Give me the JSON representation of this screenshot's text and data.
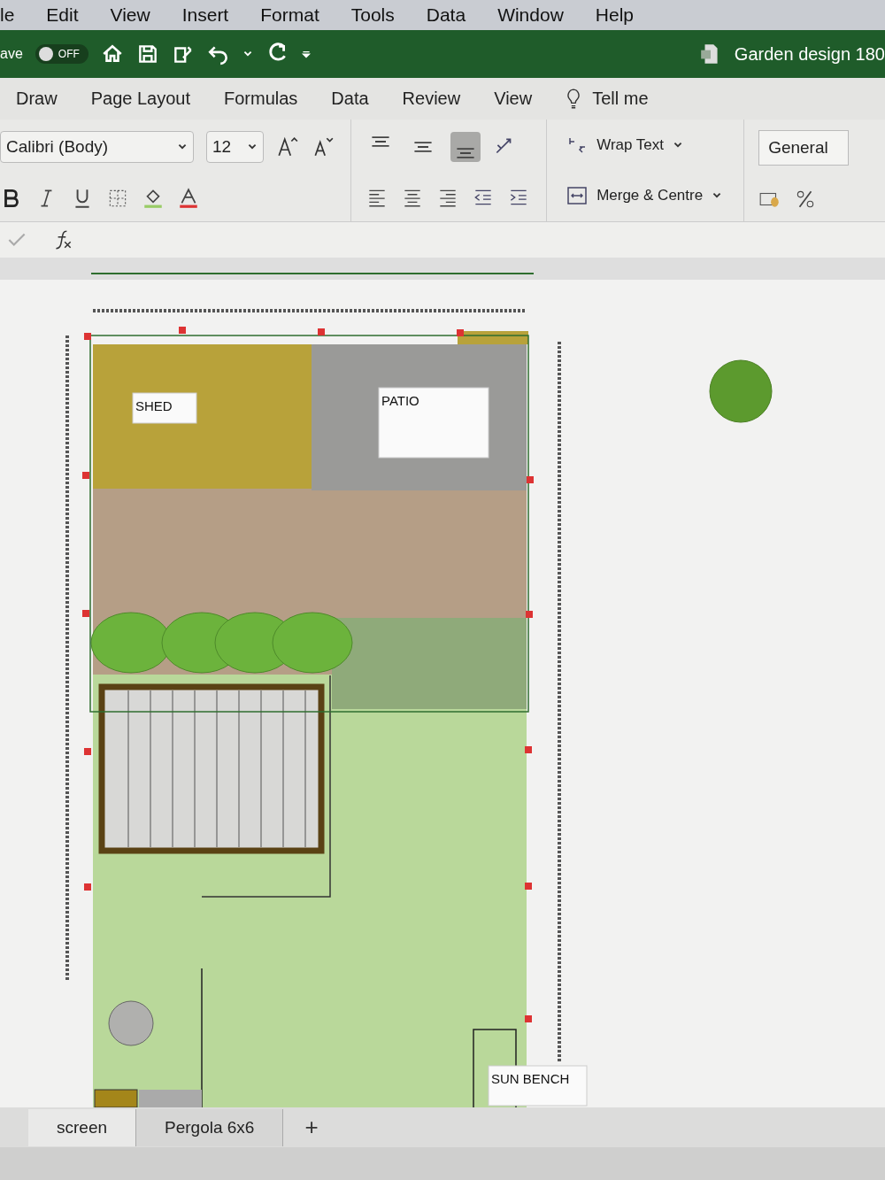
{
  "menu_bar": [
    "le",
    "Edit",
    "View",
    "Insert",
    "Format",
    "Tools",
    "Data",
    "Window",
    "Help"
  ],
  "quick_access": {
    "autosave_label": "ave",
    "toggle": {
      "label": "OFF",
      "on": false
    },
    "title": "Garden design 180"
  },
  "ribbon_tabs": [
    "Draw",
    "Page Layout",
    "Formulas",
    "Data",
    "Review",
    "View"
  ],
  "tell_me": "Tell me",
  "font": {
    "family": "Calibri (Body)",
    "size": "12"
  },
  "vertical_align": [
    {
      "selected": false
    },
    {
      "selected": false
    },
    {
      "selected": true
    }
  ],
  "wrap_text": "Wrap Text",
  "merge": "Merge & Centre",
  "number_format": "General",
  "plan_labels": [
    {
      "kind": "shed",
      "text": "SHED"
    },
    {
      "kind": "patio",
      "text": "PATIO"
    },
    {
      "kind": "bench",
      "text": "SUN BENCH"
    }
  ],
  "sheet_tabs": [
    {
      "label": "screen",
      "selected": true
    },
    {
      "label": "Pergola 6x6",
      "selected": false
    }
  ],
  "add_sheet": "+"
}
